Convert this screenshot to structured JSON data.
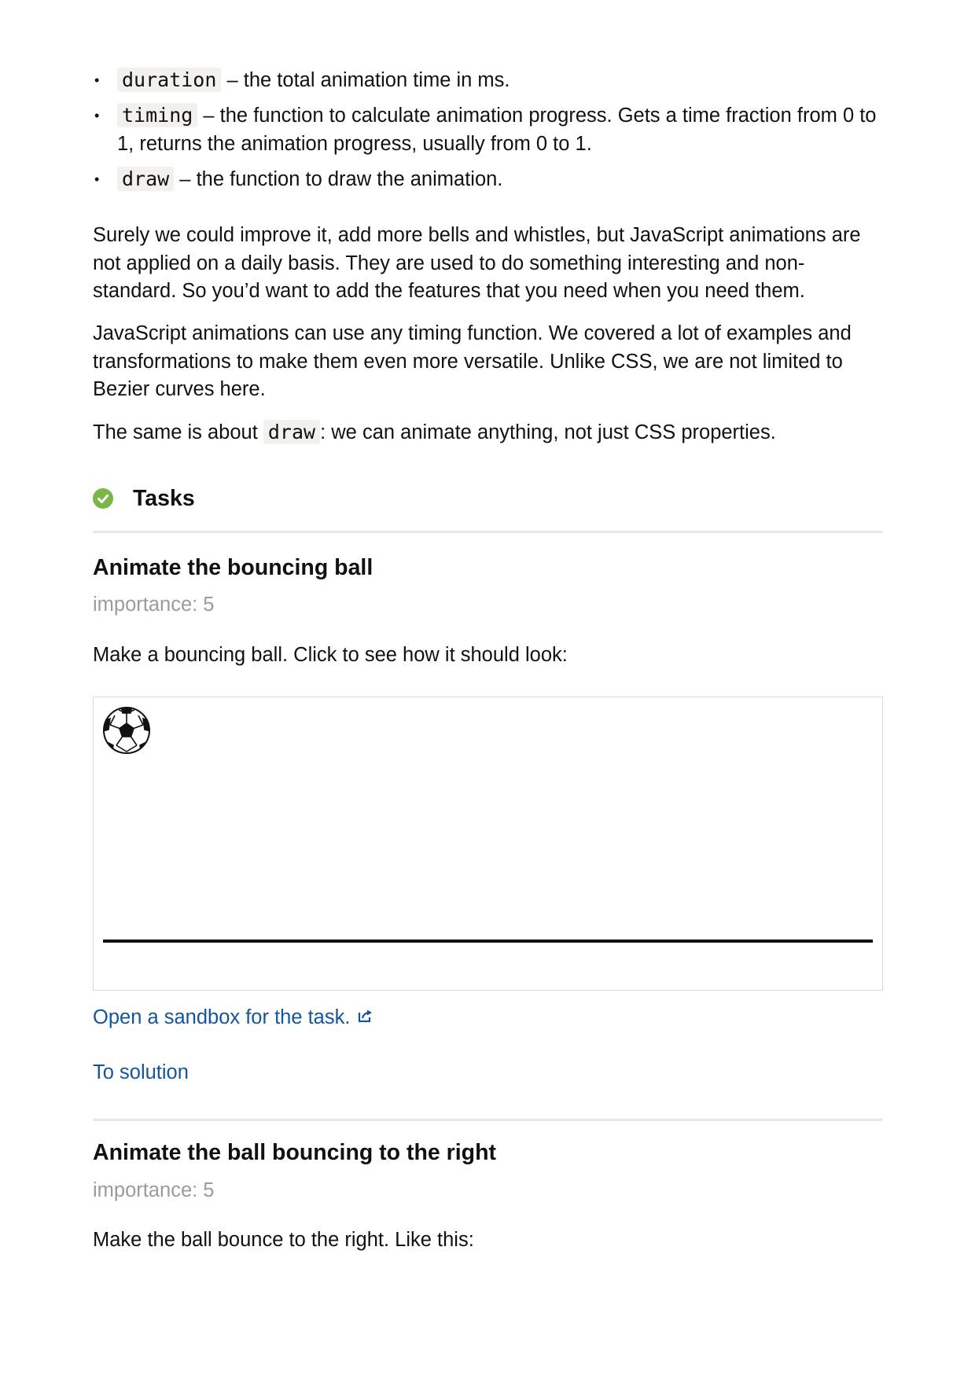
{
  "params": [
    {
      "code": "duration",
      "text": " – the total animation time in ms."
    },
    {
      "code": "timing",
      "text": " – the function to calculate animation progress. Gets a time fraction from 0 to 1, returns the animation progress, usually from 0 to 1."
    },
    {
      "code": "draw",
      "text": " – the function to draw the animation."
    }
  ],
  "paragraphs": [
    "Surely we could improve it, add more bells and whistles, but JavaScript animations are not applied on a daily basis. They are used to do something interesting and non-standard. So you’d want to add the features that you need when you need them.",
    "JavaScript animations can use any timing function. We covered a lot of examples and transformations to make them even more versatile. Unlike CSS, we are not limited to Bezier curves here."
  ],
  "draw_para": {
    "before": "The same is about ",
    "code": "draw",
    "after": ": we can animate anything, not just CSS properties."
  },
  "tasks_heading": "Tasks",
  "tasks": [
    {
      "title": "Animate the bouncing ball",
      "importance": "importance: 5",
      "description": "Make a bouncing ball. Click to see how it should look:",
      "sandbox_link": "Open a sandbox for the task.",
      "solution_link": "To solution"
    },
    {
      "title": "Animate the ball bouncing to the right",
      "importance": "importance: 5",
      "description": "Make the ball bounce to the right. Like this:"
    }
  ],
  "colors": {
    "link": "#14559c",
    "check": "#7ab648",
    "muted": "#9b9b9b"
  }
}
